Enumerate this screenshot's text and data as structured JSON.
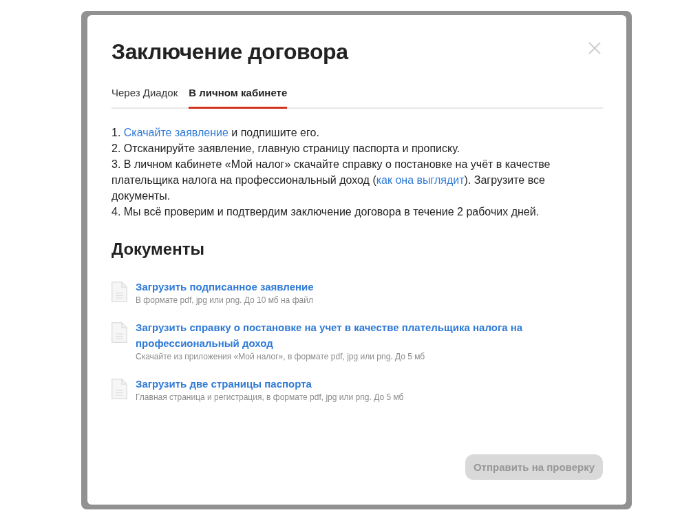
{
  "dialog": {
    "title": "Заключение договора",
    "tabs": [
      {
        "label": "Через Диадок",
        "selected": false
      },
      {
        "label": "В личном кабинете",
        "selected": true
      }
    ],
    "steps": [
      {
        "parts": [
          {
            "kind": "text",
            "text": "1. "
          },
          {
            "kind": "link",
            "text": "Скачайте заявление"
          },
          {
            "kind": "text",
            "text": " и подпишите его."
          }
        ]
      },
      {
        "parts": [
          {
            "kind": "text",
            "text": "2. Отсканируйте заявление, главную страницу паспорта и прописку."
          }
        ]
      },
      {
        "parts": [
          {
            "kind": "text",
            "text": "3. В личном кабинете «Мой налог» скачайте справку о постановке на учёт в качестве плательщика налога на профессиональный доход ("
          },
          {
            "kind": "link",
            "text": "как она выглядит"
          },
          {
            "kind": "text",
            "text": "). Загрузите все документы."
          }
        ]
      },
      {
        "parts": [
          {
            "kind": "text",
            "text": "4. Мы всё проверим и подтвердим заключение договора в течение 2 рабочих дней."
          }
        ]
      }
    ],
    "documents": {
      "heading": "Документы",
      "items": [
        {
          "title": "Загрузить подписанное заявление",
          "hint": "В формате pdf, jpg или png. До 10 мб на файл"
        },
        {
          "title": "Загрузить справку о постановке на учет в качестве плательщика налога на профессиональный доход",
          "hint": "Скачайте из приложения «Мой налог», в формате pdf, jpg или png. До 5 мб"
        },
        {
          "title": "Загрузить две страницы паспорта",
          "hint": "Главная страница и регистрация, в формате pdf, jpg или png. До 5 мб"
        }
      ]
    },
    "submit_button": {
      "label": "Отправить на проверку",
      "disabled": true
    }
  }
}
